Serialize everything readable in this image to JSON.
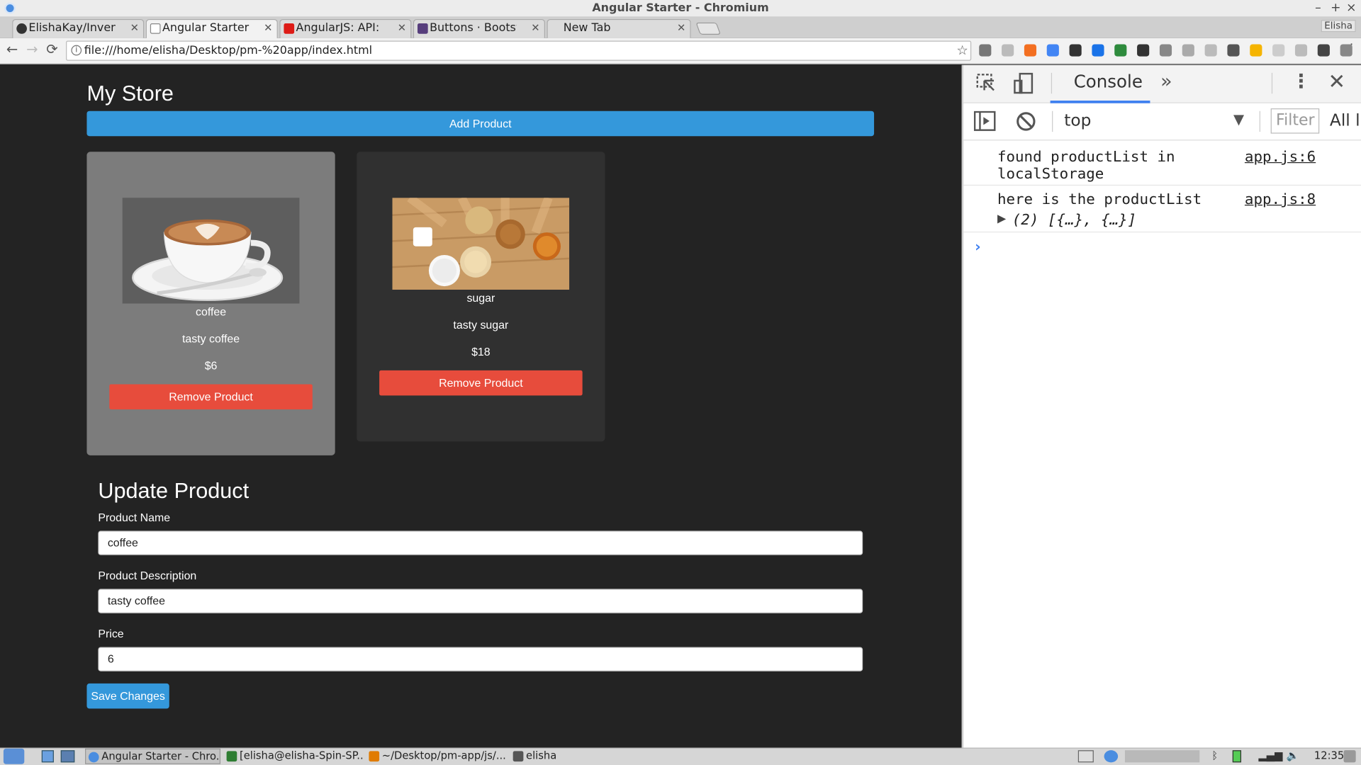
{
  "window": {
    "title": "Angular Starter - Chromium",
    "controls": [
      "–",
      "+",
      "×"
    ]
  },
  "tabs": [
    {
      "label": "ElishaKay/Inventor",
      "icon": "github-icon",
      "color": "#333333",
      "active": false
    },
    {
      "label": "Angular Starter",
      "icon": "page-icon",
      "color": "#ffffff",
      "active": true
    },
    {
      "label": "AngularJS: API: $lo",
      "icon": "angular-icon",
      "color": "#dd1b16",
      "active": false
    },
    {
      "label": "Buttons · Bootstrap",
      "icon": "bootstrap-icon",
      "color": "#563d7c",
      "active": false
    },
    {
      "label": "New Tab",
      "icon": "",
      "color": "",
      "active": false
    }
  ],
  "profile_label": "Elisha",
  "toolbar": {
    "back": "←",
    "forward": "→",
    "reload": "⟳",
    "url": "file:///home/elisha/Desktop/pm-%20app/index.html",
    "star": "☆",
    "menu": "⋮"
  },
  "extensions": [
    "#777777",
    "#bbbbbb",
    "#f36f21",
    "#4285f4",
    "#333333",
    "#1a73e8",
    "#2e8b3d",
    "#333333",
    "#888888",
    "#aaaaaa",
    "#bbbbbb",
    "#555555",
    "#f5b400",
    "#cccccc",
    "#bbbbbb",
    "#444444",
    "#888888"
  ],
  "page": {
    "title": "My Store",
    "add_button": "Add Product",
    "products": [
      {
        "name": "coffee",
        "description": "tasty coffee",
        "price": "$6",
        "remove": "Remove Product"
      },
      {
        "name": "sugar",
        "description": "tasty sugar",
        "price": "$18",
        "remove": "Remove Product"
      }
    ],
    "update": {
      "title": "Update Product",
      "name_label": "Product Name",
      "name_value": "coffee",
      "desc_label": "Product Description",
      "desc_value": "tasty coffee",
      "price_label": "Price",
      "price_value": "6",
      "save_button": "Save Changes"
    }
  },
  "devtools": {
    "console_tab": "Console",
    "more_tabs": "»",
    "context": "top",
    "filter_placeholder": "Filter",
    "levels": "All l",
    "logs": [
      {
        "message": "found productList in\nlocalStorage",
        "source": "app.js:6"
      },
      {
        "message": "here is the productList",
        "detail": "(2) [{…}, {…}]",
        "source": "app.js:8"
      }
    ],
    "prompt": "›"
  },
  "taskbar": {
    "items": [
      {
        "label": "Angular Starter - Chro...",
        "color": "#4a8de0"
      },
      {
        "label": "[elisha@elisha-Spin-SP...",
        "color": "#2e7d32"
      },
      {
        "label": "~/Desktop/pm-app/js/...",
        "color": "#e07b00"
      },
      {
        "label": "elisha",
        "color": "#555555"
      }
    ],
    "clock": "12:35"
  }
}
